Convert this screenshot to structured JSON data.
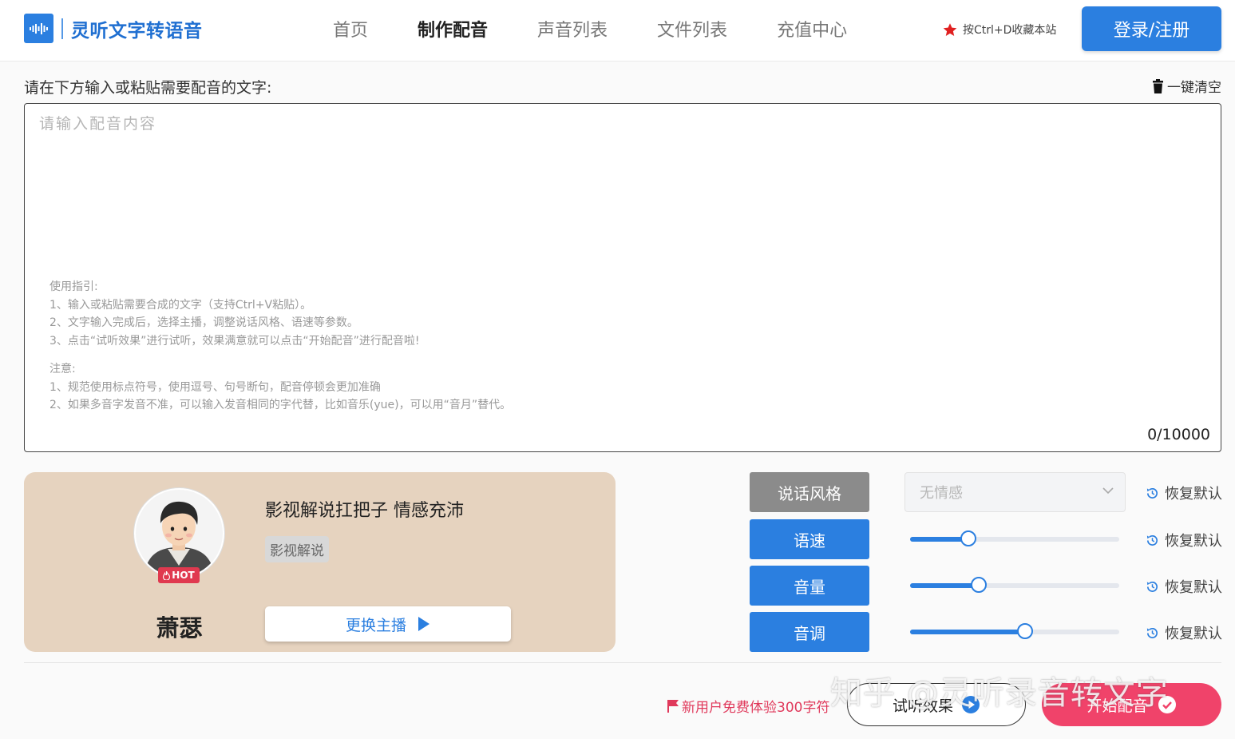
{
  "header": {
    "logo_text": "灵听文字转语音",
    "nav": [
      "首页",
      "制作配音",
      "声音列表",
      "文件列表",
      "充值中心"
    ],
    "active_nav": "制作配音",
    "bookmark_text": "按Ctrl+D收藏本站",
    "login_label": "登录/注册"
  },
  "editor": {
    "prompt": "请在下方输入或粘贴需要配音的文字:",
    "clear_label": "一键清空",
    "placeholder": "请输入配音内容",
    "guide": {
      "title": "使用指引:",
      "steps": [
        "1、输入或粘贴需要合成的文字（支持Ctrl+V粘贴）。",
        "2、文字输入完成后，选择主播，调整说话风格、语速等参数。",
        "3、点击“试听效果”进行试听，效果满意就可以点击“开始配音”进行配音啦!"
      ],
      "note_title": "注意:",
      "notes": [
        "1、规范使用标点符号，使用逗号、句号断句，配音停顿会更加准确",
        "2、如果多音字发音不准，可以输入发音相同的字代替，比如音乐(yue)，可以用“音月”替代。"
      ]
    },
    "counter": "0/10000"
  },
  "speaker": {
    "name": "萧瑟",
    "badge": "HOT",
    "description": "影视解说扛把子 情感充沛",
    "tag": "影视解说",
    "change_label": "更换主播"
  },
  "params": {
    "style": {
      "label": "说话风格",
      "value": "无情感"
    },
    "speed": {
      "label": "语速",
      "level": 0.28
    },
    "volume": {
      "label": "音量",
      "level": 0.33
    },
    "pitch": {
      "label": "音调",
      "level": 0.55
    },
    "reset_label": "恢复默认"
  },
  "actions": {
    "promo": "新用户免费体验300字符",
    "preview_label": "试听效果",
    "start_label": "开始配音"
  },
  "watermark": "知乎 @灵听录音转文字",
  "colors": {
    "primary": "#2b7fe0",
    "accent": "#f0436a",
    "card_bg": "#e6d3bf"
  }
}
